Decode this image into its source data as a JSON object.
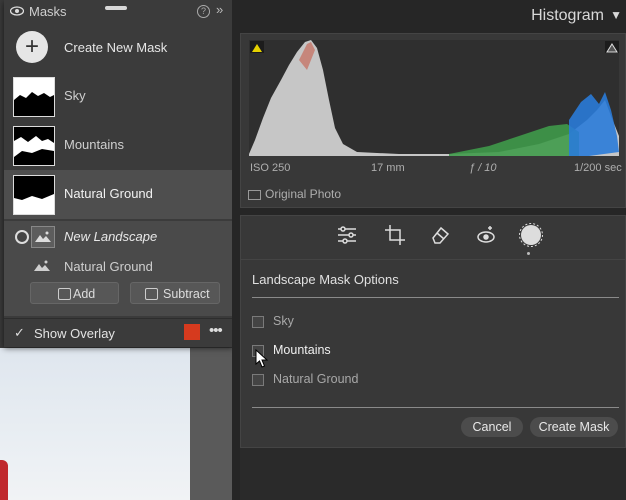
{
  "masks_panel": {
    "title": "Masks",
    "help": "?",
    "collapse": "»",
    "create_label": "Create New Mask",
    "create_plus": "+",
    "masks": [
      {
        "label": "Sky"
      },
      {
        "label": "Mountains"
      },
      {
        "label": "Natural Ground"
      }
    ],
    "sub_group": {
      "name": "New Landscape",
      "component": "Natural Ground"
    },
    "add_label": "Add",
    "subtract_label": "Subtract",
    "overlay_label": "Show Overlay",
    "overlay_check": "✓",
    "overlay_color": "#d63a1e",
    "more": "•••"
  },
  "histogram": {
    "title": "Histogram",
    "caret": "▼",
    "iso": "ISO 250",
    "focal": "17 mm",
    "aperture": "ƒ / 10",
    "shutter": "1/200 sec",
    "original_photo": "Original Photo"
  },
  "tools": [
    "sliders-icon",
    "crop-icon",
    "eraser-icon",
    "redeye-icon",
    "masking-icon"
  ],
  "landscape_options": {
    "title": "Landscape Mask Options",
    "options": [
      {
        "label": "Sky",
        "checked": false
      },
      {
        "label": "Mountains",
        "checked": true
      },
      {
        "label": "Natural Ground",
        "checked": false
      }
    ],
    "cancel": "Cancel",
    "create_mask": "Create Mask"
  }
}
